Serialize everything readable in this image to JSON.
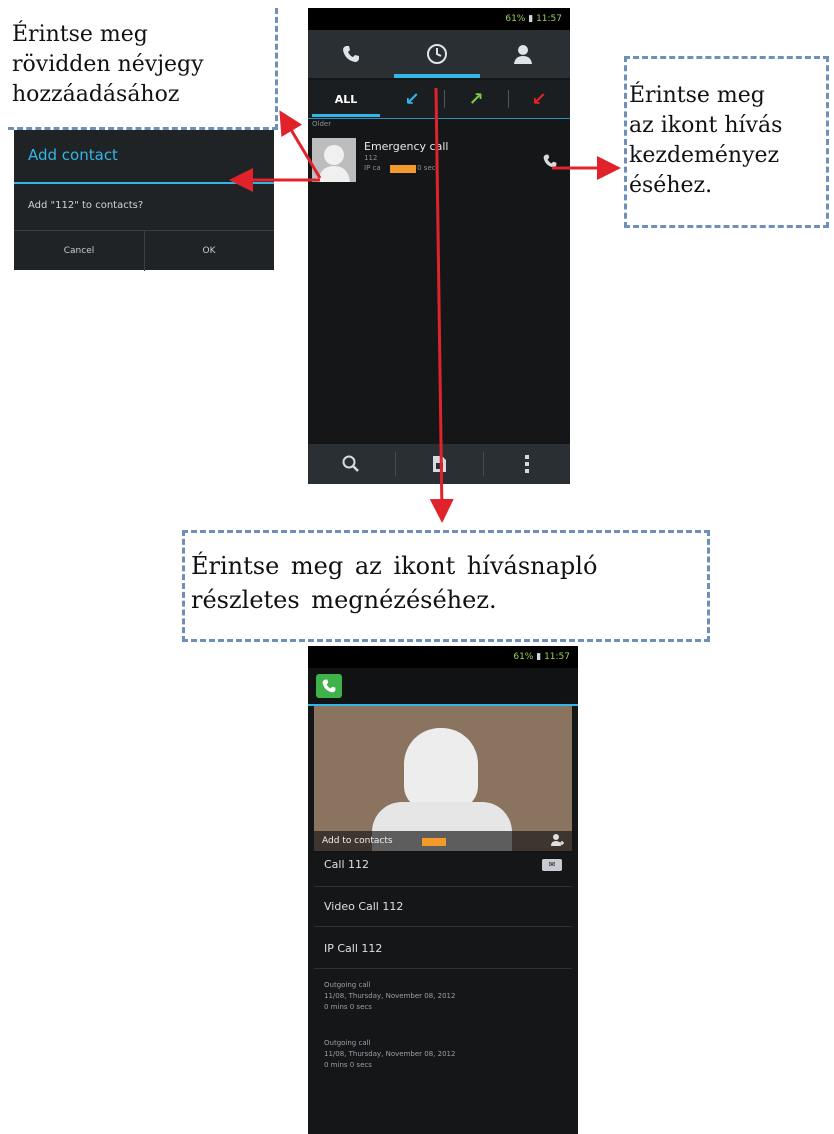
{
  "callouts": {
    "top_left": {
      "lines": [
        "Érintse meg",
        "rövidden névjegy",
        "hozzáadásához"
      ]
    },
    "right": {
      "lines": [
        "Érintse meg",
        "az ikont hívás",
        "kezdeményez",
        "éséhez."
      ]
    },
    "middle": {
      "lines": [
        "Érintse meg az ikont hívásnapló",
        "részletes megnézéséhez."
      ]
    }
  },
  "calllog_screen": {
    "status": {
      "battery": "61%",
      "time": "11:57"
    },
    "tabs": [
      {
        "icon": "phone-icon"
      },
      {
        "icon": "clock-icon"
      },
      {
        "icon": "person-icon"
      }
    ],
    "filters": {
      "all_label": "ALL"
    },
    "section_label": "Older",
    "row": {
      "name": "Emergency call",
      "number": "112",
      "meta": "IP ca",
      "meta_right": "0 sec"
    },
    "bottom_icons": [
      "search-icon",
      "sim-card-icon",
      "overflow-menu-icon"
    ]
  },
  "add_contact_dialog": {
    "title": "Add contact",
    "message": "Add \"112\" to contacts?",
    "cancel": "Cancel",
    "ok": "OK"
  },
  "details_screen": {
    "status": {
      "battery": "61%",
      "time": "11:57"
    },
    "add_to_contacts": "Add to contacts",
    "items": [
      "Call 112",
      "Video Call 112",
      "IP Call 112"
    ],
    "log": [
      {
        "type": "Outgoing call",
        "date": "11/08, Thursday, November 08, 2012",
        "duration": "0 mins 0 secs"
      },
      {
        "type": "Outgoing call",
        "date": "11/08, Thursday, November 08, 2012",
        "duration": "0 mins 0 secs"
      }
    ],
    "colors": {
      "accent": "#33b5e5",
      "tag": "#f39a2b",
      "arrow": "#e0232b"
    }
  }
}
